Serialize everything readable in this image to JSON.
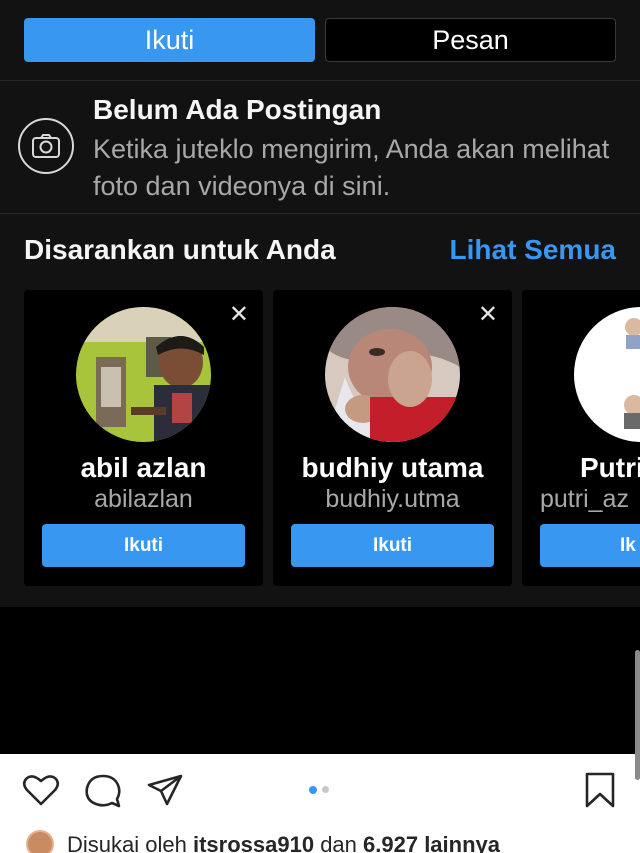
{
  "profile_actions": {
    "follow_label": "Ikuti",
    "message_label": "Pesan"
  },
  "empty_posts": {
    "title": "Belum Ada Postingan",
    "message": "Ketika juteklo mengirim, Anda akan melihat foto dan videonya di sini."
  },
  "suggestions": {
    "title": "Disarankan untuk Anda",
    "see_all_label": "Lihat Semua",
    "cards": [
      {
        "name": "abil azlan",
        "username": "abilazlan",
        "follow_label": "Ikuti",
        "dismiss_icon": "close-icon"
      },
      {
        "name": "budhiy utama",
        "username": "budhiy.utma",
        "follow_label": "Ikuti",
        "dismiss_icon": "close-icon"
      },
      {
        "name": "Putri A",
        "username": "putri_az",
        "follow_label": "Ik"
      }
    ]
  },
  "post_bar": {
    "icons": [
      "heart-icon",
      "comment-icon",
      "share-icon",
      "bookmark-icon"
    ],
    "carousel": {
      "count": 2,
      "active_index": 0
    },
    "liked_by_prefix": "Disukai oleh",
    "liked_by_user": "itsrossa910",
    "liked_by_connector": "dan",
    "liked_by_others": "6.927 lainnya"
  },
  "colors": {
    "accent": "#3897f0",
    "background": "#121212",
    "text_muted": "#a8a8a8"
  }
}
